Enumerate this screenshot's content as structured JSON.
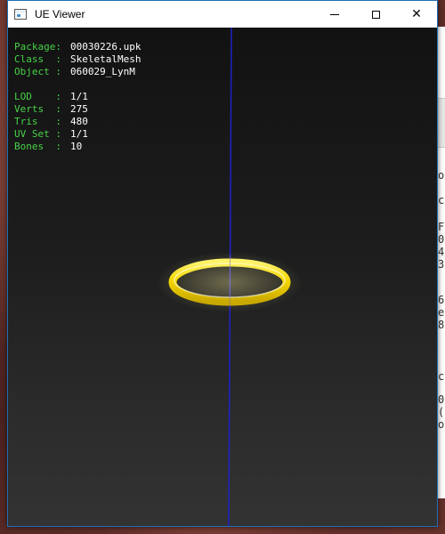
{
  "window": {
    "title": "UE Viewer",
    "buttons": {
      "minimize": "minimize-icon",
      "maximize": "maximize-icon",
      "close": "close-icon"
    }
  },
  "info": {
    "package_label": "Package",
    "package_value": "00030226.upk",
    "class_label": "Class",
    "class_value": "SkeletalMesh",
    "object_label": "Object",
    "object_value": "060029_LynM",
    "lod_label": "LOD",
    "lod_value": "1/1",
    "verts_label": "Verts",
    "verts_value": "275",
    "tris_label": "Tris",
    "tris_value": "480",
    "uvset_label": "UV Set",
    "uvset_value": "1/1",
    "bones_label": "Bones",
    "bones_value": "10"
  },
  "background_window": {
    "glyphs": [
      "o",
      "c",
      "F",
      "0",
      "4",
      "3",
      "6",
      "e",
      "8",
      "c",
      "0",
      "(",
      "o"
    ]
  },
  "colors": {
    "label_green": "#46d246",
    "value_white": "#ffffff",
    "ring_gold": "#f5d800",
    "axis_blue": "#1e22c8",
    "window_border": "#1f6fb5"
  }
}
